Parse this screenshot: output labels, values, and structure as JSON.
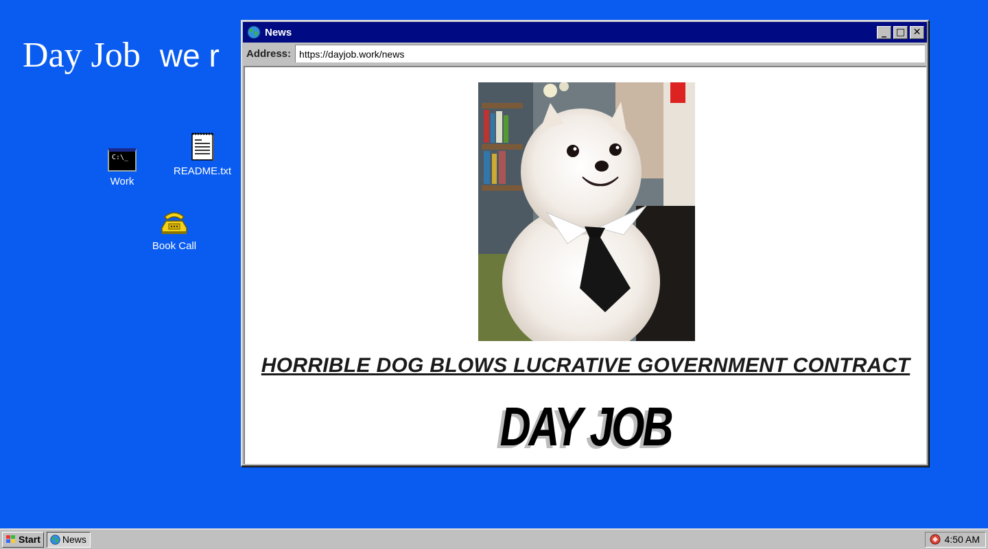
{
  "desktop": {
    "title_part1": "Day Job",
    "title_part2": "we r",
    "icons": [
      {
        "label": "Work",
        "icon": "terminal-icon",
        "glyph": "C:\\_"
      },
      {
        "label": "README.txt",
        "icon": "text-file-icon"
      },
      {
        "label": "Book Call",
        "icon": "telephone-icon"
      }
    ]
  },
  "window": {
    "title": "News",
    "controls": {
      "minimize": "_",
      "maximize": "□",
      "close": "✕"
    },
    "address_label": "Address:",
    "address_value": "https://dayjob.work/news",
    "content": {
      "image_alt": "White pomeranian dog wearing a collar and black tie",
      "headline": "HORRIBLE DOG BLOWS LUCRATIVE GOVERNMENT CONTRACT",
      "logo": "DAY JOB"
    }
  },
  "taskbar": {
    "start_label": "Start",
    "tasks": [
      {
        "label": "News",
        "icon": "globe-icon"
      }
    ],
    "clock": "4:50 AM"
  },
  "colors": {
    "desktop": "#0a5cf0",
    "titlebar": "#000a82",
    "chrome": "#c0c0c0"
  }
}
